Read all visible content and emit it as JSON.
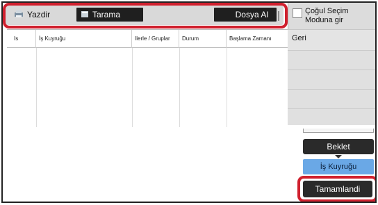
{
  "tabs": [
    {
      "label": "Yazdir",
      "icon": "print-icon",
      "active": false
    },
    {
      "label": "Tarama",
      "icon": "scan-icon",
      "active": true
    },
    {
      "label": "Dosya Al",
      "active": true
    }
  ],
  "table": {
    "columns": [
      "Is",
      "İş Kuyruğu",
      "Ilerle / Gruplar",
      "Durum",
      "Başlama Zamanı"
    ],
    "rows": []
  },
  "side_panel": {
    "multi_select_label": "Çoğul Seçim Moduna gir",
    "back_label": "Geri"
  },
  "buttons": {
    "hold_label": "Beklet",
    "job_queue_label": "İş Kuyruğu",
    "completed_label": "Tamamlandi"
  },
  "colors": {
    "highlight": "#d0202e",
    "active_button": "#6aa8e6",
    "dark_button": "#2a2a2a"
  }
}
